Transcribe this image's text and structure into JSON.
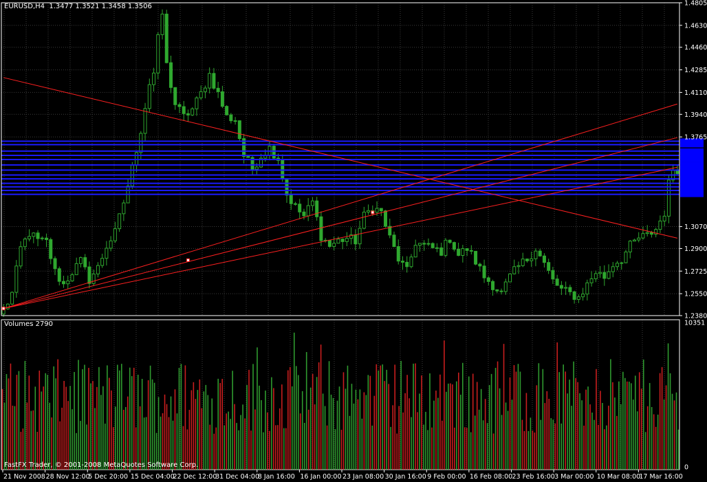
{
  "window": {
    "symbol_label": "EURUSD,H4",
    "ohlc_label": "1.3477 1.3521 1.3458 1.3506",
    "footer": "FastFX Trader, © 2001-2008 MetaQuotes Software Corp."
  },
  "colors": {
    "background": "#000000",
    "grid": "#3c3c3c",
    "axis": "#ffffff",
    "candle_up": "#2fa82f",
    "candle_down": "#2fa82f",
    "volume_up": "#2f9a2f",
    "volume_down": "#c81e1e",
    "trendline": "#ff2020",
    "level_line": "#1a1aff",
    "level_label_bg": "#0000ff"
  },
  "chart_data": [
    {
      "type": "candlestick",
      "title": "EURUSD,H4",
      "y_ticks": [
        1.4805,
        1.463,
        1.446,
        1.4285,
        1.411,
        1.394,
        1.3765,
        1.307,
        1.29,
        1.2725,
        1.255,
        1.238
      ],
      "ylim": [
        1.238,
        1.4805
      ],
      "x_ticks": [
        "21 Nov 2008",
        "28 Nov 12:00",
        "5 Dec 20:00",
        "15 Dec 04:00",
        "22 Dec 12:00",
        "31 Dec 04:00",
        "8 Jan 16:00",
        "16 Jan 00:00",
        "23 Jan 08:00",
        "30 Jan 16:00",
        "9 Feb 00:00",
        "16 Feb 08:00",
        "23 Feb 16:00",
        "3 Mar 00:00",
        "10 Mar 08:00",
        "17 Mar 16:00"
      ],
      "grid": true,
      "close_path_waypoints": [
        [
          0,
          1.242
        ],
        [
          2,
          1.255
        ],
        [
          4,
          1.29
        ],
        [
          6,
          1.302
        ],
        [
          8,
          1.296
        ],
        [
          10,
          1.295
        ],
        [
          12,
          1.272
        ],
        [
          14,
          1.262
        ],
        [
          16,
          1.272
        ],
        [
          18,
          1.28
        ],
        [
          20,
          1.266
        ],
        [
          22,
          1.275
        ],
        [
          24,
          1.292
        ],
        [
          26,
          1.302
        ],
        [
          28,
          1.326
        ],
        [
          30,
          1.352
        ],
        [
          32,
          1.382
        ],
        [
          34,
          1.418
        ],
        [
          35,
          1.426
        ],
        [
          36,
          1.452
        ],
        [
          37,
          1.472
        ],
        [
          38,
          1.432
        ],
        [
          40,
          1.402
        ],
        [
          42,
          1.392
        ],
        [
          44,
          1.398
        ],
        [
          46,
          1.41
        ],
        [
          48,
          1.425
        ],
        [
          50,
          1.41
        ],
        [
          52,
          1.392
        ],
        [
          54,
          1.39
        ],
        [
          56,
          1.362
        ],
        [
          58,
          1.352
        ],
        [
          60,
          1.362
        ],
        [
          62,
          1.368
        ],
        [
          64,
          1.36
        ],
        [
          66,
          1.332
        ],
        [
          68,
          1.322
        ],
        [
          70,
          1.315
        ],
        [
          72,
          1.326
        ],
        [
          74,
          1.3
        ],
        [
          76,
          1.292
        ],
        [
          78,
          1.296
        ],
        [
          80,
          1.298
        ],
        [
          82,
          1.296
        ],
        [
          84,
          1.315
        ],
        [
          86,
          1.322
        ],
        [
          88,
          1.318
        ],
        [
          90,
          1.298
        ],
        [
          92,
          1.282
        ],
        [
          94,
          1.272
        ],
        [
          96,
          1.295
        ],
        [
          98,
          1.292
        ],
        [
          100,
          1.29
        ],
        [
          102,
          1.288
        ],
        [
          104,
          1.298
        ],
        [
          106,
          1.285
        ],
        [
          108,
          1.29
        ],
        [
          110,
          1.28
        ],
        [
          112,
          1.268
        ],
        [
          114,
          1.262
        ],
        [
          116,
          1.255
        ],
        [
          118,
          1.268
        ],
        [
          120,
          1.276
        ],
        [
          122,
          1.282
        ],
        [
          124,
          1.29
        ],
        [
          126,
          1.278
        ],
        [
          128,
          1.265
        ],
        [
          130,
          1.258
        ],
        [
          132,
          1.255
        ],
        [
          134,
          1.252
        ],
        [
          136,
          1.262
        ],
        [
          138,
          1.272
        ],
        [
          140,
          1.268
        ],
        [
          142,
          1.278
        ],
        [
          144,
          1.282
        ],
        [
          146,
          1.292
        ],
        [
          148,
          1.298
        ],
        [
          150,
          1.3
        ],
        [
          152,
          1.305
        ],
        [
          154,
          1.318
        ],
        [
          155,
          1.34
        ],
        [
          156,
          1.352
        ]
      ],
      "trendlines": [
        {
          "start": [
            0,
            1.4225
          ],
          "end": [
            157,
            1.298
          ]
        },
        {
          "start": [
            0,
            1.2435
          ],
          "end": [
            157,
            1.402
          ]
        },
        {
          "start": [
            0,
            1.2435
          ],
          "end": [
            157,
            1.376
          ]
        },
        {
          "start": [
            0,
            1.2435
          ],
          "end": [
            157,
            1.353
          ]
        }
      ],
      "markers": [
        [
          0,
          1.2435
        ],
        [
          43,
          1.281
        ],
        [
          86,
          1.318
        ]
      ],
      "horizontal_levels": [
        1.3732,
        1.3705,
        1.3655,
        1.3622,
        1.359,
        1.3548,
        1.3508,
        1.347,
        1.344,
        1.3405,
        1.3378,
        1.335,
        1.332
      ]
    },
    {
      "type": "bar",
      "title": "Volumes 2790",
      "y_ticks": [
        10351,
        0
      ],
      "ylim": [
        0,
        10351
      ],
      "last_value": 2790
    }
  ]
}
